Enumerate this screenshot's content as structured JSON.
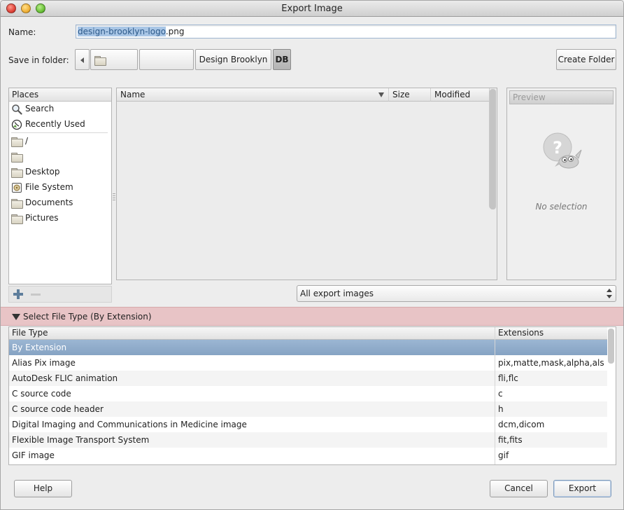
{
  "window": {
    "title": "Export Image"
  },
  "name_row": {
    "label": "Name:",
    "value_selected": "design-brooklyn-logo",
    "value_rest": ".png"
  },
  "folder_row": {
    "label": "Save in folder:",
    "path": [
      "",
      "",
      "Design Brooklyn",
      "DB"
    ],
    "create_folder_label": "Create Folder"
  },
  "places": {
    "header": "Places",
    "items": [
      {
        "label": "Search",
        "icon": "search-icon"
      },
      {
        "label": "Recently Used",
        "icon": "recent-icon"
      },
      {
        "label": "/",
        "icon": "folder-icon"
      },
      {
        "label": "",
        "icon": "folder-icon"
      },
      {
        "label": "Desktop",
        "icon": "folder-icon"
      },
      {
        "label": "File System",
        "icon": "filesystem-icon"
      },
      {
        "label": "Documents",
        "icon": "folder-icon"
      },
      {
        "label": "Pictures",
        "icon": "folder-icon"
      }
    ]
  },
  "filelist": {
    "columns": [
      "Name",
      "Size",
      "Modified"
    ]
  },
  "preview": {
    "header": "Preview",
    "empty_text": "No selection"
  },
  "filter": {
    "selected": "All export images"
  },
  "filetype": {
    "expander_label": "Select File Type (By Extension)",
    "columns": [
      "File Type",
      "Extensions"
    ],
    "rows": [
      {
        "type": "By Extension",
        "ext": ""
      },
      {
        "type": "Alias Pix image",
        "ext": "pix,matte,mask,alpha,als"
      },
      {
        "type": "AutoDesk FLIC animation",
        "ext": "fli,flc"
      },
      {
        "type": "C source code",
        "ext": "c"
      },
      {
        "type": "C source code header",
        "ext": "h"
      },
      {
        "type": "Digital Imaging and Communications in Medicine image",
        "ext": "dcm,dicom"
      },
      {
        "type": "Flexible Image Transport System",
        "ext": "fit,fits"
      },
      {
        "type": "GIF image",
        "ext": "gif"
      }
    ]
  },
  "buttons": {
    "help": "Help",
    "cancel": "Cancel",
    "export": "Export"
  },
  "colors": {
    "selection": "#a9c6e6",
    "row_selected": "#8fabcb",
    "expander": "#e8c4c6"
  }
}
